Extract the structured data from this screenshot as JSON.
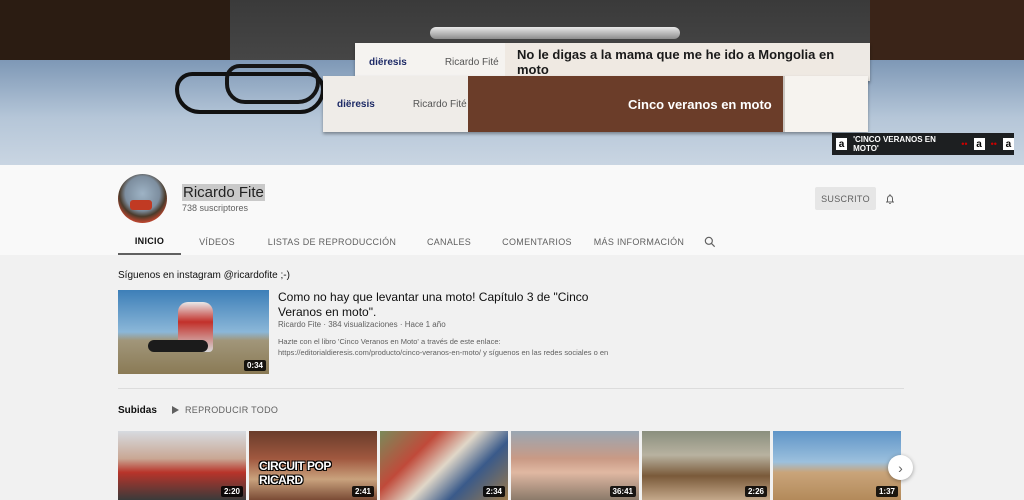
{
  "banner": {
    "book1": {
      "brand": "diëresis",
      "author": "Ricardo Fité",
      "title": "No le digas a la mama que me he ido a Mongolia en moto"
    },
    "book2": {
      "brand": "diëresis",
      "author": "Ricardo Fité",
      "title": "Cinco veranos en moto"
    },
    "link_label": "'CINCO VERANOS EN MOTO'",
    "link_icon": "a"
  },
  "channel": {
    "name": "Ricardo Fite",
    "subscribers": "738 suscriptores",
    "subscribe_label": "SUSCRITO"
  },
  "tabs": [
    {
      "label": "INICIO"
    },
    {
      "label": "VÍDEOS"
    },
    {
      "label": "LISTAS DE REPRODUCCIÓN"
    },
    {
      "label": "CANALES"
    },
    {
      "label": "COMENTARIOS"
    },
    {
      "label": "MÁS INFORMACIÓN"
    }
  ],
  "home": {
    "instagram_note": "Síguenos en instagram @ricardofite ;-)",
    "featured": {
      "title": "Como no hay que levantar una moto! Capítulo 3 de \"Cinco Veranos en moto\".",
      "channel": "Ricardo Fite",
      "views": "384 visualizaciones",
      "age": "Hace 1 año",
      "meta": "Ricardo Fite · 384 visualizaciones · Hace 1 año",
      "description": "Hazte con el libro 'Cinco Veranos en Moto' a través de este enlace: https://editorialdieresis.com/producto/cinco-veranos-en-moto/ y síguenos en las redes sociales o en",
      "duration": "0:34"
    },
    "uploads": {
      "title": "Subidas",
      "play_all": "REPRODUCIR TODO",
      "videos": [
        {
          "duration": "2:20",
          "overlay": ""
        },
        {
          "duration": "2:41",
          "overlay": "CIRCUIT POP RICARD"
        },
        {
          "duration": "2:34",
          "overlay": ""
        },
        {
          "duration": "36:41",
          "overlay": ""
        },
        {
          "duration": "2:26",
          "overlay": ""
        },
        {
          "duration": "1:37",
          "overlay": ""
        }
      ]
    }
  },
  "icons": {
    "bell": "bell-icon",
    "search": "search-icon",
    "next": "chevron-right-icon",
    "play": "play-icon"
  }
}
